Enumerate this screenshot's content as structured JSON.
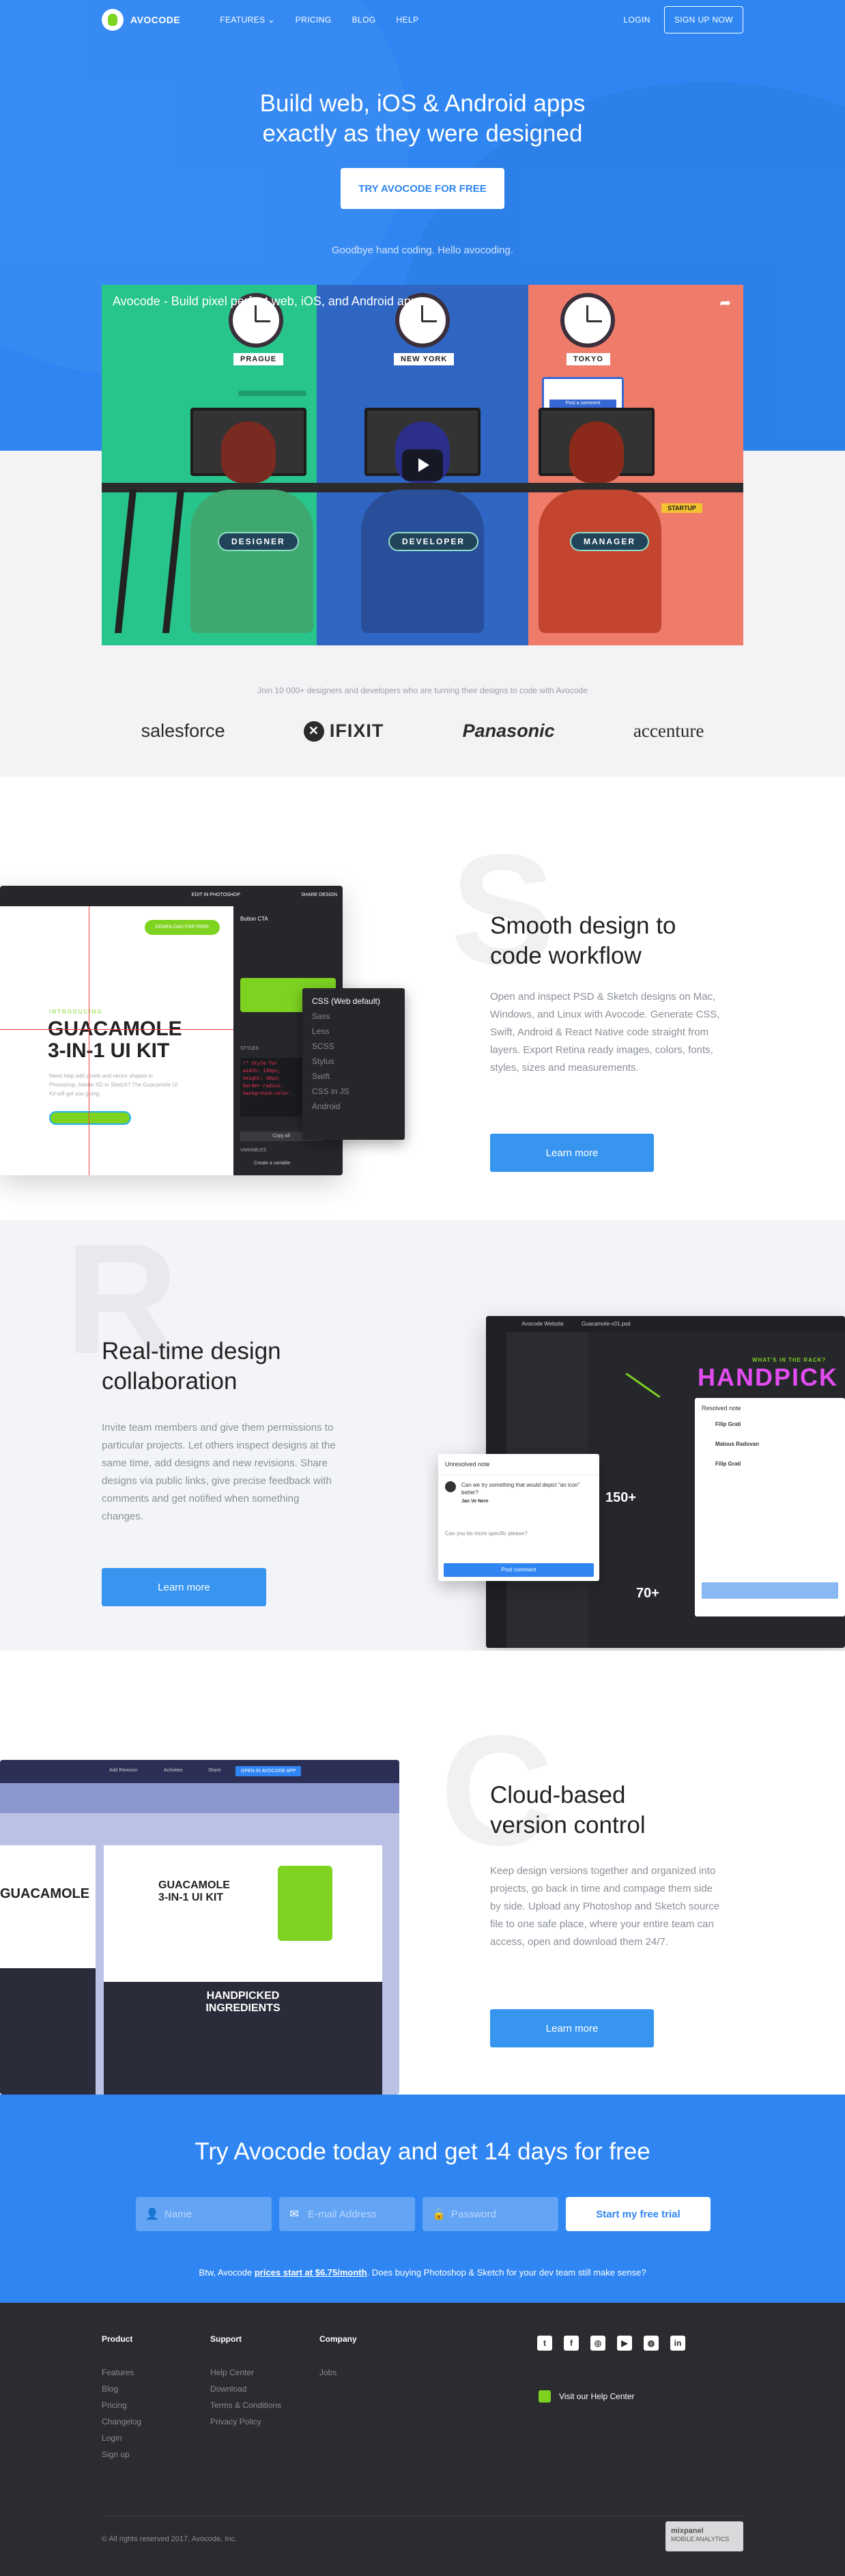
{
  "nav": {
    "logo": "AVOCODE",
    "links": [
      "FEATURES",
      "PRICING",
      "BLOG",
      "HELP"
    ],
    "login": "LOGIN",
    "signup": "SIGN UP NOW"
  },
  "hero": {
    "title_line1": "Build web, iOS & Android apps",
    "title_line2": "exactly as they were designed",
    "cta": "TRY AVOCODE FOR FREE",
    "subtitle": "Goodbye hand coding. Hello avocoding."
  },
  "video": {
    "title": "Avocode - Build pixel perfect web, iOS, and Android apps",
    "cities": [
      "PRAGUE",
      "NEW YORK",
      "TOKYO"
    ],
    "roles": [
      "DESIGNER",
      "DEVELOPER",
      "MANAGER"
    ],
    "post_comment": "Post a comment",
    "startup": "STARTUP"
  },
  "clients": {
    "text": "Join 10 000+ designers and developers who are turning their designs to code with Avocode",
    "logos": [
      "salesforce",
      "IFIXIT",
      "Panasonic",
      "accenture"
    ]
  },
  "feature1": {
    "letter": "S",
    "title_line1": "Smooth design to",
    "title_line2": "code workflow",
    "text": "Open and inspect PSD & Sketch designs on Mac, Windows, and Linux with Avocode. Generate CSS, Swift, Android & React Native code straight from layers. Export Retina ready images, colors, fonts, styles, sizes and measurements.",
    "button": "Learn more",
    "mock": {
      "edit": "EDIT IN PHOTOSHOP",
      "share": "SHARE DESIGN",
      "download": "DOWNLOAD FOR FREE",
      "introducing": "INTRODUCING",
      "headline1": "GUACAMOLE",
      "headline2": "3-IN-1 UI KIT",
      "desc": "Need help with pixels and vector shapes in Photoshop, Adobe XD or Sketch? The Guacamole UI Kit will get you going.",
      "panel_title": "Button CTA",
      "menu": [
        "CSS (Web default)",
        "Sass",
        "Less",
        "SCSS",
        "Stylus",
        "Swift",
        "CSS in JS",
        "Android"
      ],
      "styles": "STYLES",
      "copy_all": "Copy all",
      "variables": "VARIABLES",
      "create_variable": "Create a variable"
    }
  },
  "feature2": {
    "letter": "R",
    "title_line1": "Real-time design",
    "title_line2": "collaboration",
    "text": "Invite team members and give them permissions to particular projects. Let others inspect designs at the same time, add designs and new revisions. Share designs via public links, give precise feedback with comments and get notified when something changes.",
    "button": "Learn more",
    "mock": {
      "project": "Avocode Website",
      "file": "Guacamole-v01.psd",
      "unresolved": "Unresolved note",
      "question": "Can we try something that would depict \"an icon\" better?",
      "author": "Jan Ve Nere",
      "reply": "Can you be more specific please?",
      "post": "Post comment",
      "resolved": "Resolved note",
      "users": [
        "Filip Grati",
        "Matous Radovan",
        "Filip Grati"
      ],
      "stats": [
        "150+",
        "70+"
      ],
      "whats": "WHAT'S IN THE RACK?",
      "handpick": "HANDPICK"
    }
  },
  "feature3": {
    "letter": "C",
    "title_line1": "Cloud-based",
    "title_line2": "version control",
    "text": "Keep design versions together and organized into projects, go back in time and compage them side by side. Upload any Photoshop and Sketch source file to one safe place, where your entire team can access, open and download them 24/7.",
    "button": "Learn more",
    "mock": {
      "open_btn": "OPEN IN AVOCODE APP",
      "tabs": [
        "Add Revision",
        "Activities",
        "Share"
      ],
      "headline1": "GUACAMOLE",
      "headline2": "3-IN-1 UI KIT",
      "handpicked1": "HANDPICKED",
      "handpicked2": "INGREDIENTS"
    }
  },
  "trial": {
    "title": "Try Avocode today and get 14 days for free",
    "name_placeholder": "Name",
    "email_placeholder": "E-mail Address",
    "password_placeholder": "Password",
    "button": "Start my free trial",
    "note_before": "Btw, Avocode ",
    "note_link": "prices start at $6.75/month",
    "note_after": ". Does buying Photoshop & Sketch for your dev team still make sense?"
  },
  "footer": {
    "product_title": "Product",
    "product": [
      "Features",
      "Blog",
      "Pricing",
      "Changelog",
      "Login",
      "Sign up"
    ],
    "support_title": "Support",
    "support": [
      "Help Center",
      "Download",
      "Terms & Conditions",
      "Privacy Policy"
    ],
    "company_title": "Company",
    "company": [
      "Jobs"
    ],
    "help_center": "Visit our Help Center",
    "copyright": "© All rights reserved 2017, Avocode, Inc.",
    "badge_line1": "mixpanel",
    "badge_line2": "MOBILE ANALYTICS"
  },
  "colors": {
    "brand": "#2f86f2",
    "button": "#3795f0",
    "accent": "#7ed321",
    "footer": "#2b2c30"
  }
}
